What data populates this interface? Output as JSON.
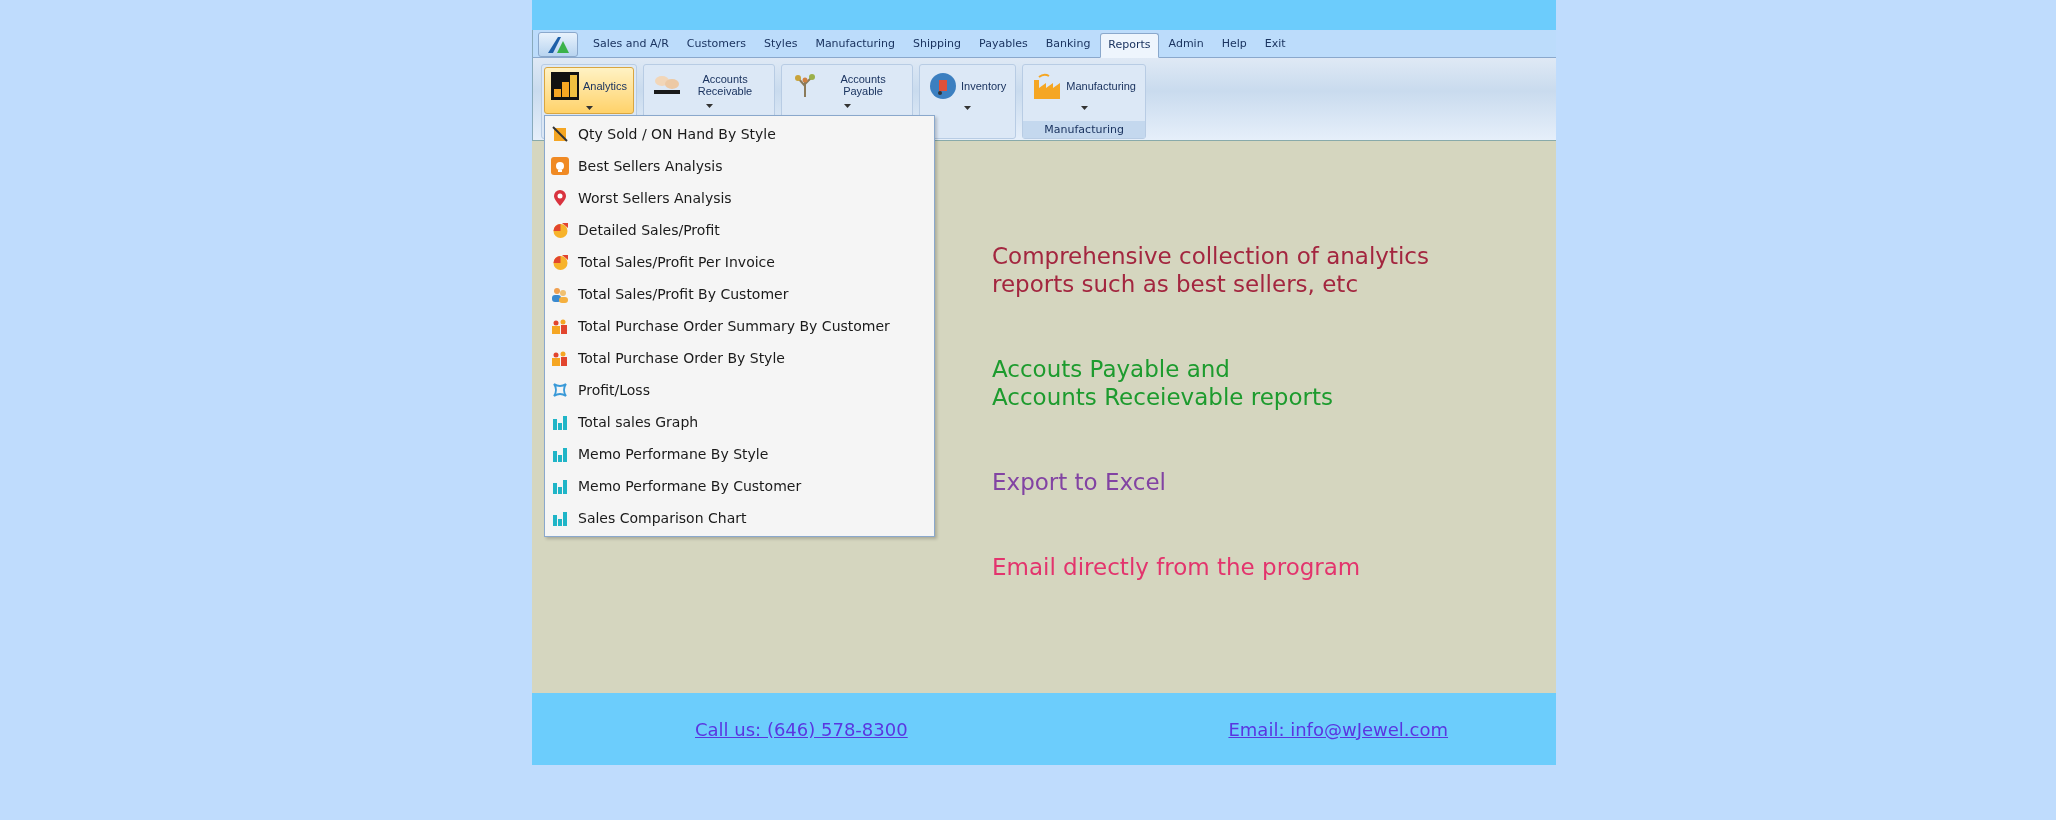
{
  "tabs": [
    {
      "label": "Sales and A/R",
      "selected": false
    },
    {
      "label": "Customers",
      "selected": false
    },
    {
      "label": "Styles",
      "selected": false
    },
    {
      "label": "Manufacturing",
      "selected": false
    },
    {
      "label": "Shipping",
      "selected": false
    },
    {
      "label": "Payables",
      "selected": false
    },
    {
      "label": "Banking",
      "selected": false
    },
    {
      "label": "Reports",
      "selected": true
    },
    {
      "label": "Admin",
      "selected": false
    },
    {
      "label": "Help",
      "selected": false
    },
    {
      "label": "Exit",
      "selected": false
    }
  ],
  "ribbon": [
    {
      "kind": "analytics",
      "label": "Analytics",
      "selected": true
    },
    {
      "kind": "hands",
      "label": "Accounts Receivable",
      "selected": false
    },
    {
      "kind": "tree",
      "label": "Accounts Payable",
      "selected": false
    },
    {
      "kind": "cart",
      "label": "Inventory",
      "selected": false
    },
    {
      "kind": "factory",
      "label": "Manufacturing",
      "selected": false,
      "group_label": "Manufacturing"
    }
  ],
  "menu": [
    {
      "kind": "crossed",
      "label": "Qty Sold / ON Hand By Style"
    },
    {
      "kind": "trophy",
      "label": "Best Sellers Analysis"
    },
    {
      "kind": "pin",
      "label": "Worst Sellers Analysis"
    },
    {
      "kind": "pie",
      "label": "Detailed Sales/Profit"
    },
    {
      "kind": "pie",
      "label": "Total Sales/Profit Per Invoice"
    },
    {
      "kind": "people",
      "label": "Total Sales/Profit By Customer"
    },
    {
      "kind": "group",
      "label": "Total Purchase Order Summary By Customer"
    },
    {
      "kind": "group",
      "label": "Total Purchase Order By Style"
    },
    {
      "kind": "frame",
      "label": "Profit/Loss"
    },
    {
      "kind": "bars",
      "label": "Total sales Graph"
    },
    {
      "kind": "bars",
      "label": "Memo Performane By Style"
    },
    {
      "kind": "bars",
      "label": "Memo Performane By Customer"
    },
    {
      "kind": "bars",
      "label": "Sales Comparison Chart"
    }
  ],
  "features": [
    {
      "lines": [
        "Comprehensive collection of analytics",
        "reports such as best sellers, etc"
      ],
      "color": "#a3263f"
    },
    {
      "lines": [
        "Accouts Payable and",
        "Accounts Receievable reports"
      ],
      "color": "#1d9b2e"
    },
    {
      "lines": [
        "Export to Excel"
      ],
      "color": "#8243a3"
    },
    {
      "lines": [
        "Email directly from the program"
      ],
      "color": "#e3346d"
    }
  ],
  "footer": {
    "phone": "Call us: (646) 578-8300",
    "email": "Email: info@wJewel.com"
  }
}
